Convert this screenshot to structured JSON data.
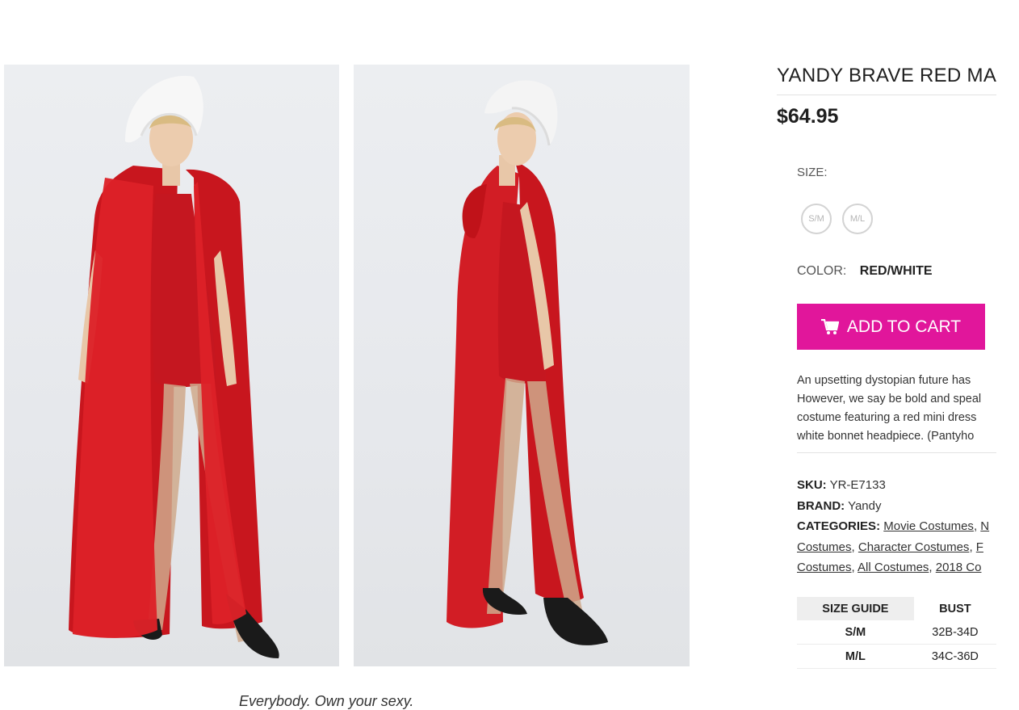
{
  "product": {
    "title": "YANDY BRAVE RED MA",
    "price": "$64.95",
    "size_label": "SIZE:",
    "sizes": [
      "S/M",
      "M/L"
    ],
    "color_label": "COLOR:",
    "color_value": "RED/WHITE",
    "add_to_cart": "ADD TO CART",
    "description_lines": [
      "An upsetting dystopian future has",
      "However, we say be bold and speal",
      "costume featuring a red mini dress",
      "white bonnet headpiece. (Pantyho"
    ],
    "sku_label": "SKU:",
    "sku": "YR-E7133",
    "brand_label": "BRAND:",
    "brand": "Yandy",
    "categories_label": "CATEGORIES:",
    "categories": [
      "Movie Costumes",
      "N",
      "Costumes",
      "Character Costumes",
      "F",
      "Costumes",
      "All Costumes",
      "2018 Co"
    ],
    "size_guide": {
      "headers": [
        "SIZE GUIDE",
        "BUST"
      ],
      "rows": [
        [
          "S/M",
          "32B-34D"
        ],
        [
          "M/L",
          "34C-36D"
        ]
      ]
    }
  },
  "caption": "Everybody. Own your sexy.",
  "colors": {
    "accent": "#e1169b",
    "cape": "#d61f26"
  },
  "icons": {
    "cart": "cart-icon"
  }
}
